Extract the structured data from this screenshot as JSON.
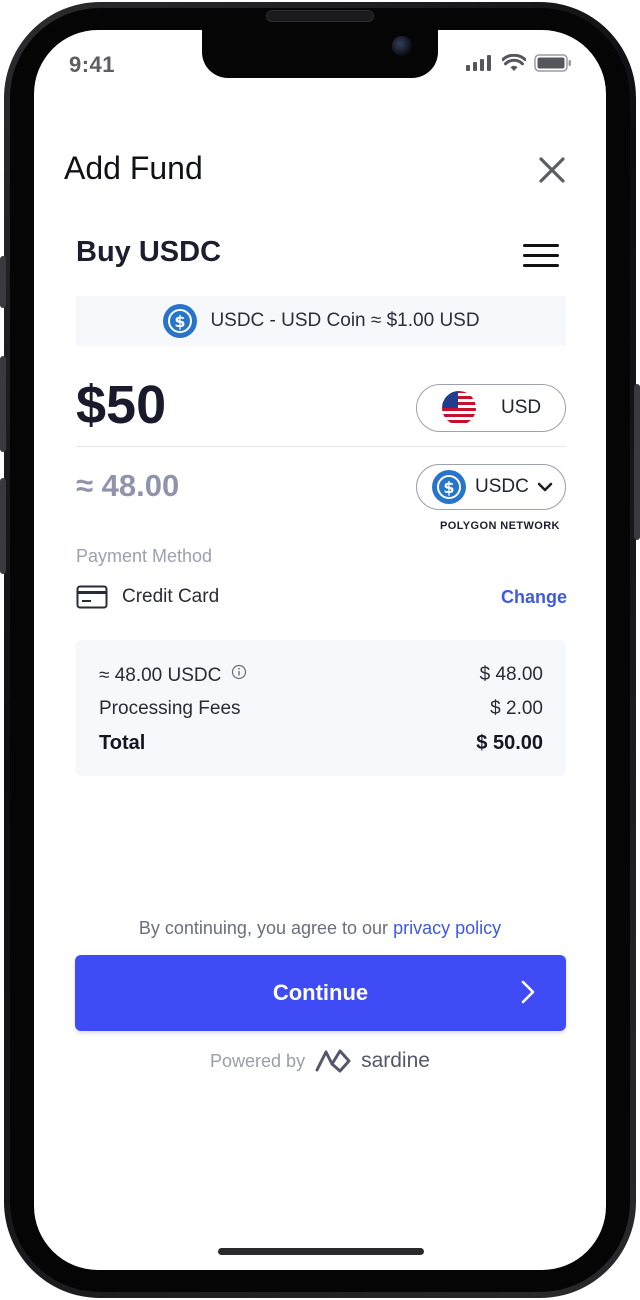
{
  "status_bar": {
    "time": "9:41"
  },
  "header": {
    "title": "Add Fund"
  },
  "widget": {
    "title": "Buy USDC",
    "rate_text": "USDC - USD Coin ≈ $1.00 USD",
    "amount": "$50",
    "fiat_currency": "USD",
    "crypto_estimate": "≈ 48.00",
    "crypto_currency": "USDC",
    "network_label": "POLYGON NETWORK",
    "payment_method_label": "Payment Method",
    "payment_method": "Credit Card",
    "change_label": "Change"
  },
  "summary": {
    "rows": [
      {
        "label": "≈ 48.00 USDC",
        "value": "$ 48.00"
      },
      {
        "label": "Processing Fees",
        "value": "$ 2.00"
      },
      {
        "label": "Total",
        "value": "$ 50.00"
      }
    ]
  },
  "footer": {
    "agree_prefix": "By continuing, you agree to our",
    "privacy_link": "privacy policy",
    "continue_label": "Continue",
    "powered_by": "Powered by",
    "brand": "sardine"
  },
  "colors": {
    "accent": "#3f4bf5",
    "link": "#3f59e4",
    "usdc_blue": "#2775ca"
  }
}
